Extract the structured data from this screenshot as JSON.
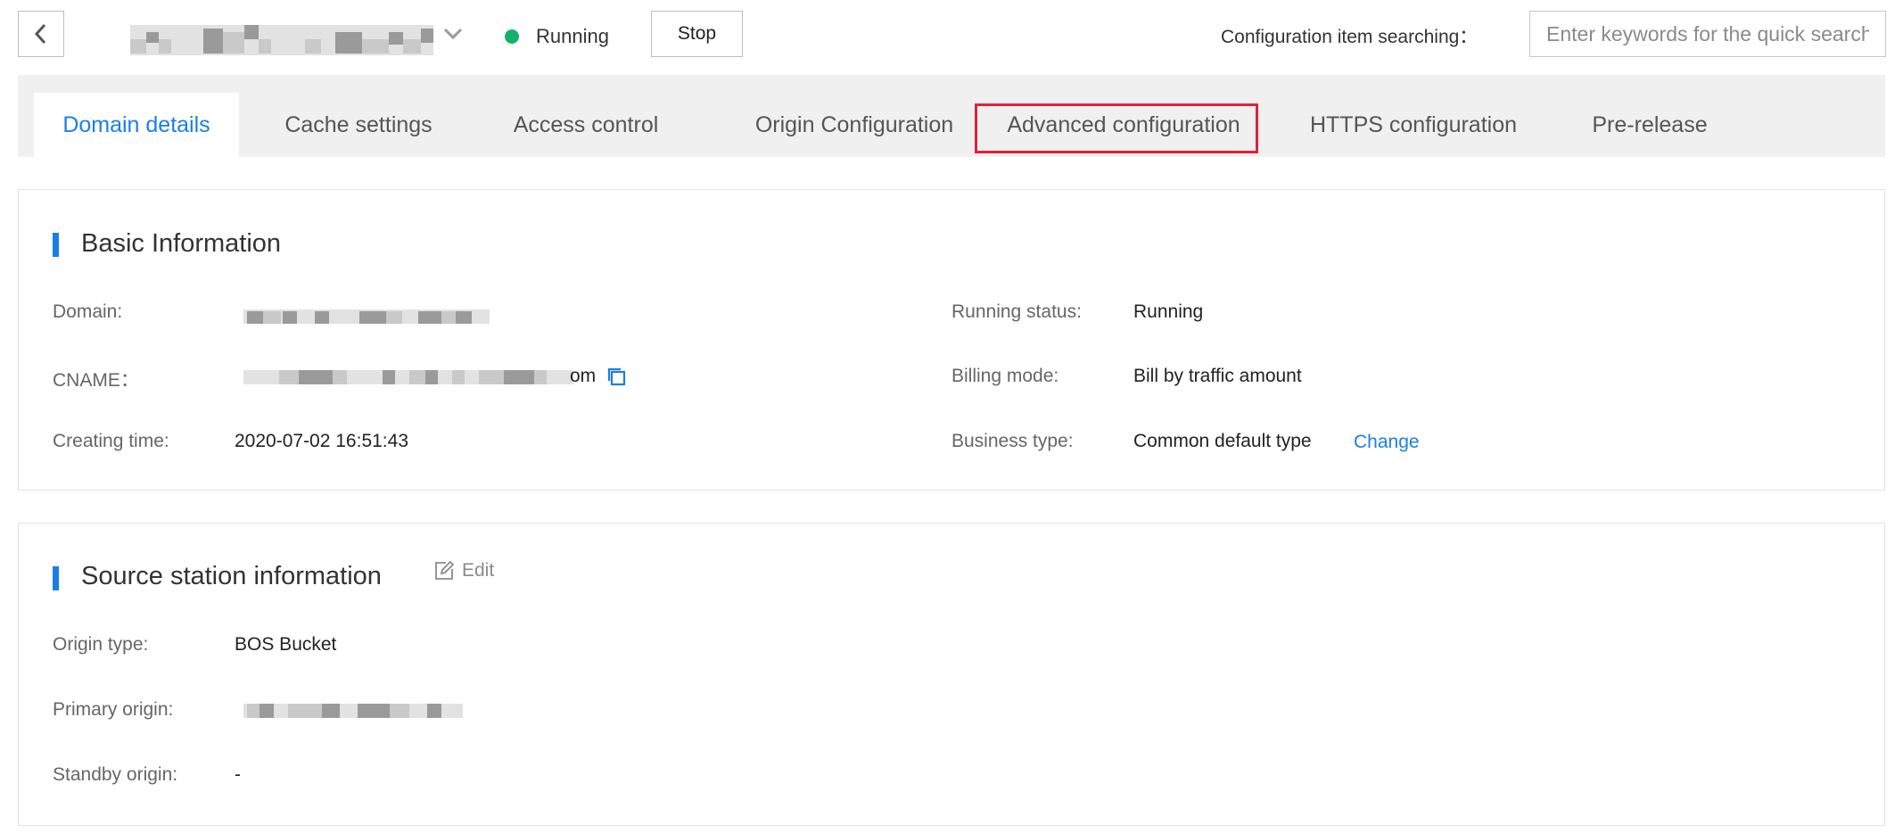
{
  "header": {
    "status": "Running",
    "stop_label": "Stop",
    "search_label": "Configuration item searching：",
    "search_placeholder": "Enter keywords for the quick search",
    "colors": {
      "running_dot": "#16b06b",
      "accent": "#1a7fe5",
      "highlight": "#e2203b"
    }
  },
  "tabs": [
    {
      "label": "Domain details",
      "active": true
    },
    {
      "label": "Cache settings",
      "active": false
    },
    {
      "label": "Access control",
      "active": false
    },
    {
      "label": "Origin Configuration",
      "active": false
    },
    {
      "label": "Advanced configuration",
      "active": false,
      "highlighted": true
    },
    {
      "label": "HTTPS configuration",
      "active": false
    },
    {
      "label": "Pre-release",
      "active": false
    }
  ],
  "basic_info": {
    "title": "Basic Information",
    "domain_label": "Domain:",
    "cname_label": "CNAME：",
    "cname_suffix": "om",
    "creating_time_label": "Creating time:",
    "creating_time": "2020-07-02 16:51:43",
    "running_status_label": "Running status:",
    "running_status": "Running",
    "billing_mode_label": "Billing mode:",
    "billing_mode": "Bill by traffic amount",
    "business_type_label": "Business type:",
    "business_type": "Common default type",
    "change_label": "Change"
  },
  "source_info": {
    "title": "Source station information",
    "edit_label": "Edit",
    "origin_type_label": "Origin type:",
    "origin_type": "BOS Bucket",
    "primary_origin_label": "Primary origin:",
    "standby_origin_label": "Standby origin:",
    "standby_origin": "-"
  }
}
